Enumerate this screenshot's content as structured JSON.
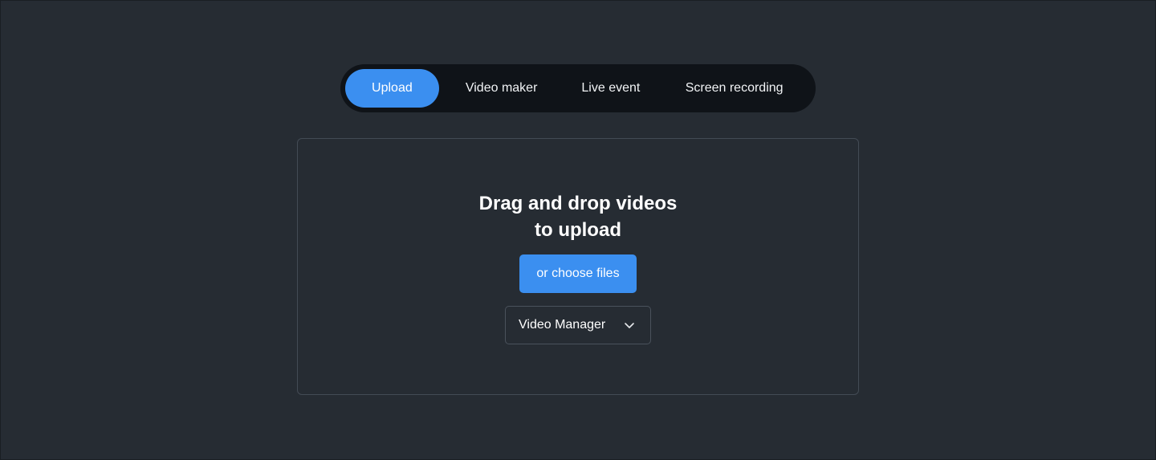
{
  "tabs": [
    {
      "id": "upload",
      "label": "Upload",
      "active": true
    },
    {
      "id": "video-maker",
      "label": "Video maker",
      "active": false
    },
    {
      "id": "live-event",
      "label": "Live event",
      "active": false
    },
    {
      "id": "screen-recording",
      "label": "Screen recording",
      "active": false
    }
  ],
  "dropzone": {
    "title_line1": "Drag and drop videos",
    "title_line2": "to upload",
    "choose_label": "or choose files",
    "destination_selected": "Video Manager"
  },
  "icons": {
    "destination_chevron": "chevron-down-icon"
  },
  "colors": {
    "background": "#262c33",
    "tabbar_background": "#0f1318",
    "accent": "#3b8ff0",
    "border": "#434b55",
    "text": "#ffffff"
  }
}
